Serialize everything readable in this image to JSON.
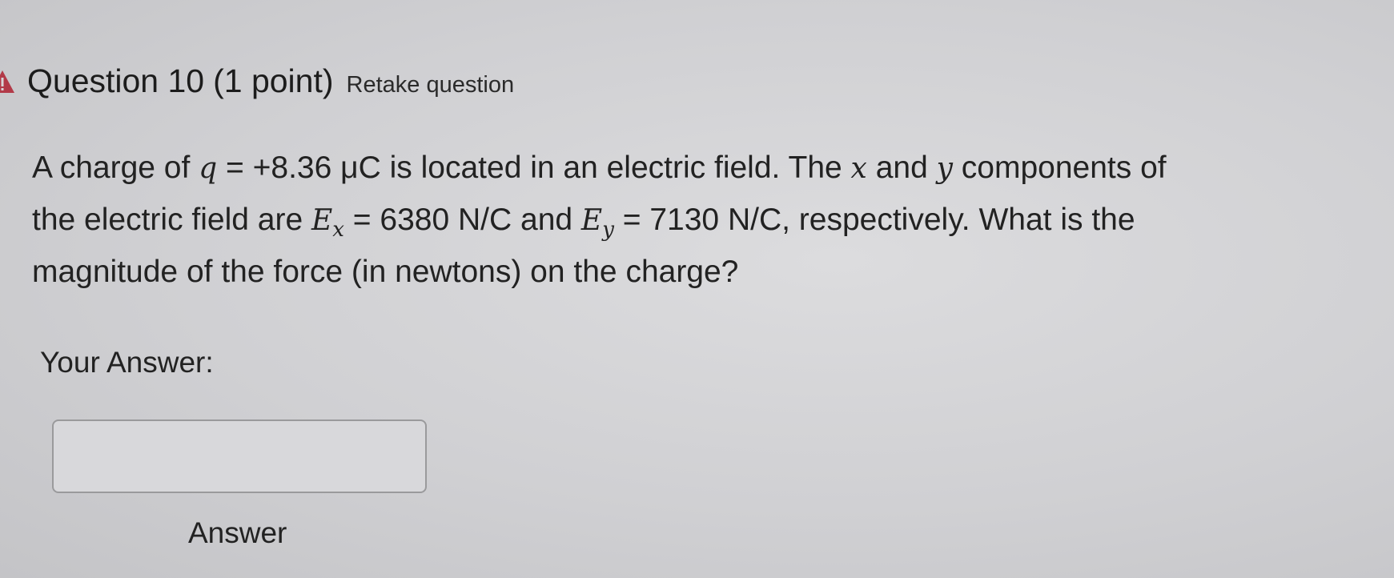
{
  "header": {
    "warning_icon": "warning-icon",
    "warning_icon_color": "#b23a48",
    "title": "Question 10",
    "points": "(1 point)",
    "retake": "Retake question"
  },
  "question": {
    "line1_a": "A charge of ",
    "line1_q": "q",
    "line1_b": " = +8.36 μC is located in an electric field. The ",
    "line1_x": "x",
    "line1_c": " and ",
    "line1_y": "y",
    "line1_d": " components of",
    "line2_a": "the electric field are ",
    "line2_ex": "E",
    "line2_ex_sub": "x",
    "line2_b": " = 6380 N/C and ",
    "line2_ey": "E",
    "line2_ey_sub": "y",
    "line2_c": " = 7130 N/C, respectively. What is the",
    "line3": "magnitude of the force (in newtons) on the charge?"
  },
  "answer": {
    "label": "Your Answer:",
    "input_value": "",
    "caption": "Answer"
  }
}
